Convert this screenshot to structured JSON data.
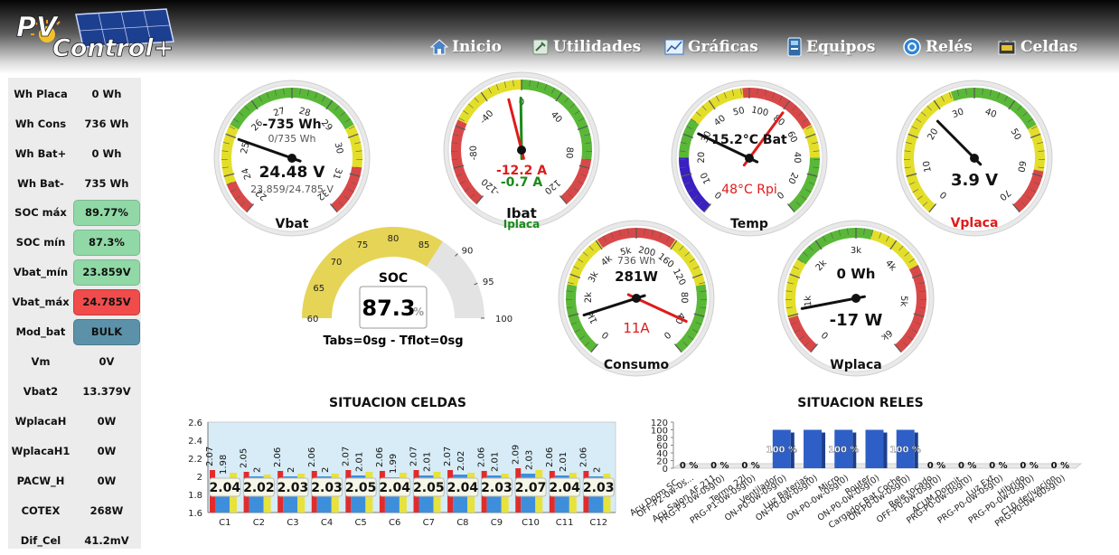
{
  "brand": {
    "logo_text": "PVControl+"
  },
  "nav": [
    {
      "label": "Inicio",
      "icon": "home-icon"
    },
    {
      "label": "Utilidades",
      "icon": "tools-icon"
    },
    {
      "label": "Gráficas",
      "icon": "chart-icon"
    },
    {
      "label": "Equipos",
      "icon": "device-icon"
    },
    {
      "label": "Relés",
      "icon": "relay-icon"
    },
    {
      "label": "Celdas",
      "icon": "battery-icon"
    }
  ],
  "sidebar": [
    {
      "key": "Wh Placa",
      "value": "0 Wh",
      "status": ""
    },
    {
      "key": "Wh Cons",
      "value": "736 Wh",
      "status": ""
    },
    {
      "key": "Wh Bat+",
      "value": "0 Wh",
      "status": ""
    },
    {
      "key": "Wh Bat-",
      "value": "735 Wh",
      "status": ""
    },
    {
      "key": "SOC máx",
      "value": "89.77%",
      "status": "green"
    },
    {
      "key": "SOC mín",
      "value": "87.3%",
      "status": "green"
    },
    {
      "key": "Vbat_mín",
      "value": "23.859V",
      "status": "green"
    },
    {
      "key": "Vbat_máx",
      "value": "24.785V",
      "status": "red"
    },
    {
      "key": "Mod_bat",
      "value": "BULK",
      "status": "blue"
    },
    {
      "key": "Vm",
      "value": "0V",
      "status": ""
    },
    {
      "key": "Vbat2",
      "value": "13.379V",
      "status": ""
    },
    {
      "key": "WplacaH",
      "value": "0W",
      "status": ""
    },
    {
      "key": "WplacaH1",
      "value": "0W",
      "status": ""
    },
    {
      "key": "PACW_H",
      "value": "0W",
      "status": ""
    },
    {
      "key": "COTEX",
      "value": "268W",
      "status": ""
    },
    {
      "key": "Dif_Cel",
      "value": "41.2mV",
      "status": ""
    }
  ],
  "gauges": {
    "vbat": {
      "label": "Vbat",
      "line1": "-735 Wh",
      "line2": "0/735 Wh",
      "value_text": "24.48 V",
      "range_text": "23.859/24.785 V",
      "ticks": [
        "22",
        "24",
        "25",
        "26",
        "27",
        "28",
        "29",
        "30",
        "31",
        "32"
      ],
      "value": 24.48
    },
    "ibat": {
      "label": "Ibat",
      "label2": "Iplaca",
      "value_text": "-12.2 A",
      "value2_text": "-0.7 A",
      "ticks": [
        "-120",
        "-80",
        "-40",
        "0",
        "40",
        "80",
        "120"
      ],
      "value": -12.2,
      "value2": -0.7
    },
    "temp": {
      "label": "Temp",
      "line1": "15.2°C Bat",
      "line2": "48°C Rpi",
      "ticks": [
        "0",
        "10",
        "20",
        "30",
        "40",
        "50",
        "100",
        "80",
        "60",
        "40",
        "20",
        "0"
      ],
      "value": 15.2,
      "value2": 48
    },
    "vplaca": {
      "label": "Vplaca",
      "value_text": "3.9 V",
      "ticks": [
        "0",
        "10",
        "20",
        "30",
        "40",
        "50",
        "60",
        "70"
      ],
      "value": 3.9
    },
    "soc": {
      "label": "SOC",
      "value_text": "87.3",
      "unit": "%",
      "footer": "Tabs=0sg - Tflot=0sg",
      "ticks": [
        "60",
        "65",
        "70",
        "75",
        "80",
        "85",
        "90",
        "95",
        "100"
      ],
      "value": 87.3
    },
    "consumo": {
      "label": "Consumo",
      "line1": "736 Wh",
      "line2": "281W",
      "line3": "11A",
      "ticks": [
        "0",
        "1k",
        "2k",
        "3k",
        "4k",
        "5k",
        "200",
        "160",
        "120",
        "80",
        "40",
        "0"
      ],
      "value": 281,
      "value2": 11
    },
    "wplaca": {
      "label": "Wplaca",
      "line1": "0 Wh",
      "value_text": "-17 W",
      "ticks": [
        "0",
        "1k",
        "2k",
        "3k",
        "4k",
        "5k",
        "6k"
      ],
      "value": -17
    }
  },
  "colors": {
    "green": "#59b837",
    "yellow": "#e3de2a",
    "red": "#d94848",
    "blue_bar": "#2e5fc7",
    "cell_red": "#e22b2b",
    "cell_blue": "#3d8fdc",
    "cell_yellow": "#e7e23c"
  },
  "chart_data": [
    {
      "type": "bar",
      "title": "SITUACION CELDAS",
      "categories": [
        "C1",
        "C2",
        "C3",
        "C4",
        "C5",
        "C6",
        "C7",
        "C8",
        "C9",
        "C10",
        "C11",
        "C12"
      ],
      "series": [
        {
          "values": [
            2.07,
            2.05,
            2.06,
            2.06,
            2.07,
            2.06,
            2.07,
            2.07,
            2.06,
            2.09,
            2.06,
            2.06
          ]
        },
        {
          "values": [
            1.98,
            2.0,
            2.0,
            2.0,
            2.01,
            1.99,
            2.01,
            2.02,
            2.01,
            2.03,
            2.01,
            2.0
          ]
        },
        {
          "values": [
            2.04,
            2.02,
            2.03,
            2.03,
            2.05,
            2.04,
            2.05,
            2.04,
            2.03,
            2.07,
            2.04,
            2.03
          ]
        }
      ],
      "yticks": [
        "1.6",
        "1.8",
        "2",
        "2.2",
        "2.4",
        "2.6"
      ],
      "ylim": [
        1.6,
        2.6
      ],
      "grid": false
    },
    {
      "type": "bar",
      "title": "SITUACION RELES",
      "categories": [
        "Acu Dorm SC...",
        "OFF-P2-0w-0s...",
        "Acu Salon AF 211",
        "PRG-P3-0w-0sg(0)",
        "Termo 22l",
        "PRG-P1-0w-0sg(0)",
        "Ventilador",
        "ON-P0-0w-0sg(0)",
        "Luz Baterias",
        "ON-P0-0w-0sg(0)",
        "Micro",
        "ON-P0-0w-0sg(0)",
        "Router",
        "ON-P0-0w-0sg(0)",
        "Cargador Bat Coche",
        "ON-P0-0w-0sg(0)",
        "Rele tocado",
        "OFF-P0-0w-0sg(0)",
        "ACUM.Dormit.",
        "PRG-P0-0w-0sg(0)",
        "Luz Ext",
        "PRG-P0-0w-0sg(0)",
        "Hibrido",
        "PRG-P0-0w-0sg(0)",
        "C10 derivacion",
        "PRG-P0-0w-60sg(0)"
      ],
      "bars": [
        {
          "value": 0,
          "label": "0 %"
        },
        {
          "value": 0,
          "label": "0 %"
        },
        {
          "value": 0,
          "label": "0 %"
        },
        {
          "value": 100,
          "label": "100 %"
        },
        {
          "value": 100,
          "label": ""
        },
        {
          "value": 100,
          "label": "100 %"
        },
        {
          "value": 100,
          "label": ""
        },
        {
          "value": 100,
          "label": "100 %"
        },
        {
          "value": 0,
          "label": "0 %"
        },
        {
          "value": 0,
          "label": "0 %"
        },
        {
          "value": 0,
          "label": "0 %"
        },
        {
          "value": 0,
          "label": "0 %"
        },
        {
          "value": 0,
          "label": "0 %"
        }
      ],
      "xlabels": [
        "Acu Dorm SC...",
        "OFF-P2-0w-0s...",
        "Acu Salon AF 211",
        "PRG-P3-0w-0sg(0)",
        "Termo 22l",
        "PRG-P1-0w-0sg(0)",
        "Ventilador",
        "ON-P0-0w-0sg(0)",
        "Luz Baterias",
        "ON-P0-0w-0sg(0)",
        "Micro",
        "ON-P0-0w-0sg(0)",
        "Router",
        "ON-P0-0w-0sg(0)",
        "Cargador Bat Coche",
        "ON-P0-0w-0sg(0)",
        "Rele tocado",
        "OFF-P0-0w-0sg(0)",
        "ACUM.Dormit.",
        "PRG-P0-0w-0sg(0)",
        "Luz Ext",
        "PRG-P0-0w-0sg(0)",
        "Hibrido",
        "PRG-P0-0w-0sg(0)",
        "C10 derivacion",
        "PRG-P0-0w-60sg(0)"
      ],
      "yticks": [
        "0",
        "20",
        "40",
        "60",
        "80",
        "100",
        "120"
      ],
      "ylim": [
        0,
        120
      ]
    }
  ]
}
